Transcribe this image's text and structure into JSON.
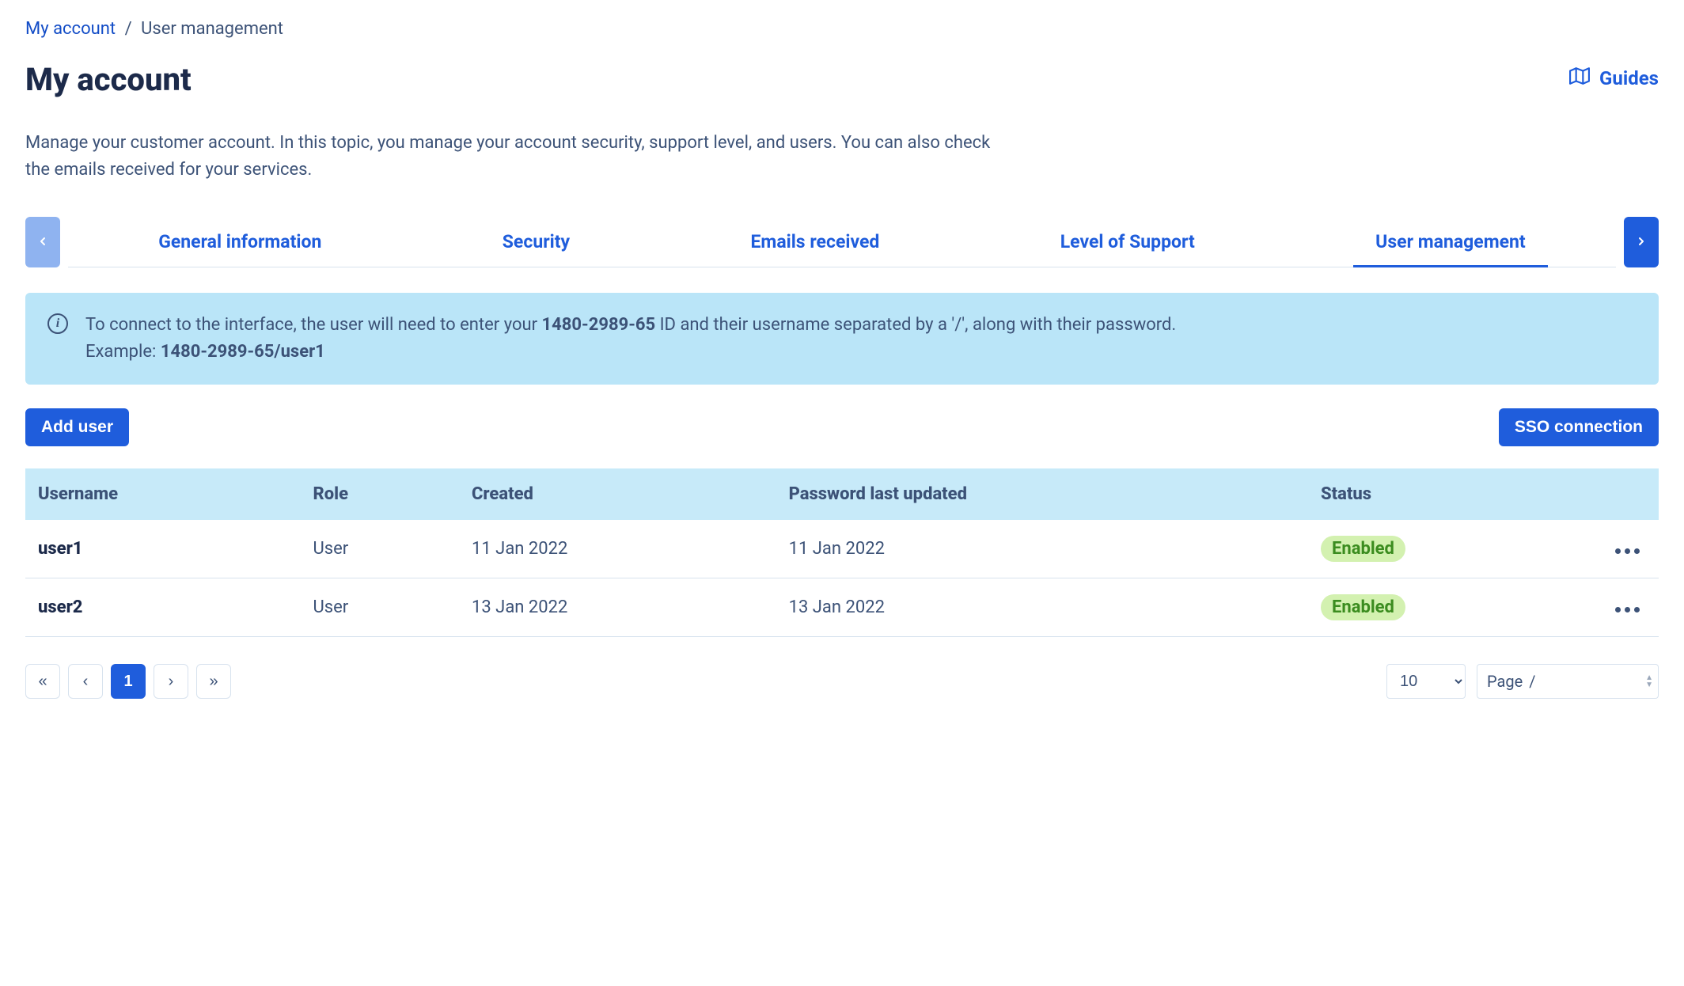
{
  "breadcrumb": {
    "root": "My account",
    "current": "User management"
  },
  "header": {
    "title": "My account",
    "guides_label": "Guides",
    "subtitle": "Manage your customer account. In this topic, you manage your account security, support level, and users. You can also check the emails received for your services."
  },
  "tabs": {
    "items": [
      {
        "label": "General information",
        "active": false
      },
      {
        "label": "Security",
        "active": false
      },
      {
        "label": "Emails received",
        "active": false
      },
      {
        "label": "Level of Support",
        "active": false
      },
      {
        "label": "User management",
        "active": true
      }
    ]
  },
  "info": {
    "text_pre": "To connect to the interface, the user will need to enter your ",
    "account_id": "1480-2989-65",
    "text_post": " ID and their username separated by a '/', along with their password.",
    "example_label": "Example: ",
    "example_value": "1480-2989-65/user1"
  },
  "actions": {
    "add_user": "Add user",
    "sso": "SSO connection"
  },
  "table": {
    "columns": {
      "username": "Username",
      "role": "Role",
      "created": "Created",
      "password_updated": "Password last updated",
      "status": "Status"
    },
    "rows": [
      {
        "username": "user1",
        "role": "User",
        "created": "11 Jan 2022",
        "password_updated": "11 Jan 2022",
        "status": "Enabled"
      },
      {
        "username": "user2",
        "role": "User",
        "created": "13 Jan 2022",
        "password_updated": "13 Jan 2022",
        "status": "Enabled"
      }
    ]
  },
  "pagination": {
    "first": "«",
    "prev": "‹",
    "current": "1",
    "next": "›",
    "last": "»",
    "page_size": "10",
    "page_label": "Page",
    "page_sep": "/"
  }
}
